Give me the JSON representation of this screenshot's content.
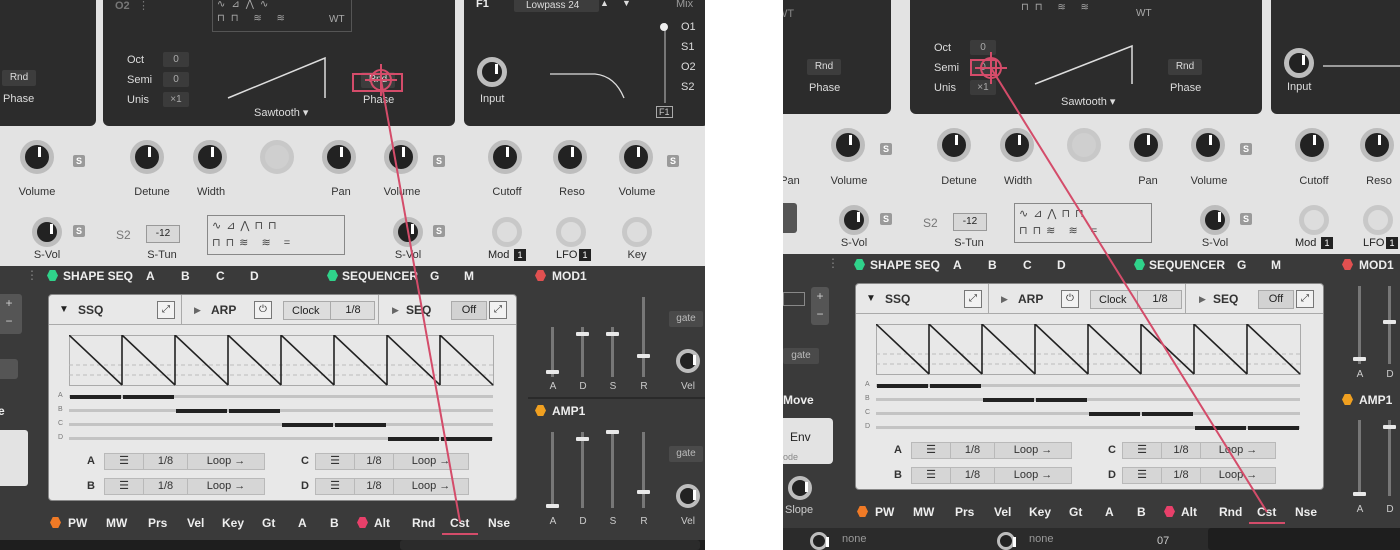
{
  "left": {
    "osc": {
      "title": "O2",
      "oct_label": "Oct",
      "semi_label": "Semi",
      "unis_label": "Unis",
      "oct_value": "0",
      "semi_value": "0",
      "unis_value": "×1",
      "wave_name": "Sawtooth ▾",
      "rnd": "Rnd",
      "phase": "Phase",
      "wt": "WT",
      "left_rnd": "Rnd",
      "left_phase": "Phase"
    },
    "filter": {
      "title": "F1",
      "type": "Lowpass 24",
      "input": "Input",
      "mix": "Mix",
      "routes": [
        "O1",
        "S1",
        "O2",
        "S2"
      ],
      "f1_chip": "F1"
    },
    "knobs": {
      "volume_left": "Volume",
      "detune": "Detune",
      "width": "Width",
      "pan": "Pan",
      "volume": "Volume",
      "cutoff": "Cutoff",
      "reso": "Reso",
      "volume_f": "Volume"
    },
    "sub": {
      "svol_left": "S-Vol",
      "s2": "S2",
      "stun_value": "-12",
      "stun": "S-Tun",
      "svol": "S-Vol",
      "mod": "Mod",
      "lfo": "LFO",
      "key": "Key",
      "mod_badge": "1",
      "lfo_badge": "1"
    },
    "strip": {
      "shape_seq": "SHAPE SEQ",
      "a": "A",
      "b": "B",
      "c": "C",
      "d": "D",
      "sequencer": "SEQUENCER",
      "g": "G",
      "m": "M",
      "mod1": "MOD1",
      "amp1": "AMP1"
    },
    "ssq": {
      "ssq": "SSQ",
      "arp": "ARP",
      "clock": "Clock",
      "clock_value": "1/8",
      "seq": "SEQ",
      "off": "Off"
    },
    "lanes": [
      "A",
      "B",
      "C",
      "D"
    ],
    "rows": [
      {
        "label": "A",
        "rate": "1/8",
        "mode": "Loop →"
      },
      {
        "label": "B",
        "rate": "1/8",
        "mode": "Loop →"
      },
      {
        "label": "C",
        "rate": "1/8",
        "mode": "Loop →"
      },
      {
        "label": "D",
        "rate": "1/8",
        "mode": "Loop →"
      }
    ],
    "env": [
      "A",
      "D",
      "S",
      "R"
    ],
    "gate": "gate",
    "vel": "Vel",
    "bottom": [
      "PW",
      "MW",
      "Prs",
      "Vel",
      "Key",
      "Gt",
      "A",
      "B",
      "Alt",
      "Rnd",
      "Cst",
      "Nse"
    ],
    "left_e": "e"
  },
  "right": {
    "osc": {
      "wt": "WT",
      "oct_label": "Oct",
      "semi_label": "Semi",
      "unis_label": "Unis",
      "oct_value": "0",
      "semi_value": "0",
      "unis_value": "×1",
      "wave_name": "Sawtooth ▾",
      "rnd_left": "Rnd",
      "phase_left": "Phase",
      "rnd": "Rnd",
      "phase": "Phase",
      "input": "Input"
    },
    "knobs": {
      "pan_left": "Pan",
      "volume_left": "Volume",
      "detune": "Detune",
      "width": "Width",
      "pan": "Pan",
      "volume": "Volume",
      "cutoff": "Cutoff",
      "reso": "Reso"
    },
    "sub": {
      "svol_left": "S-Vol",
      "s2": "S2",
      "stun_value": "-12",
      "stun": "S-Tun",
      "svol": "S-Vol",
      "mod": "Mod",
      "lfo": "LFO",
      "mod_badge": "1",
      "lfo_badge": "1"
    },
    "strip": {
      "shape_seq": "SHAPE SEQ",
      "a": "A",
      "b": "B",
      "c": "C",
      "d": "D",
      "sequencer": "SEQUENCER",
      "g": "G",
      "m": "M",
      "mod1": "MOD1",
      "amp1": "AMP1"
    },
    "ssq": {
      "ssq": "SSQ",
      "arp": "ARP",
      "clock": "Clock",
      "clock_value": "1/8",
      "seq": "SEQ",
      "off": "Off"
    },
    "rows": [
      {
        "label": "A",
        "rate": "1/8",
        "mode": "Loop →"
      },
      {
        "label": "B",
        "rate": "1/8",
        "mode": "Loop →"
      },
      {
        "label": "C",
        "rate": "1/8",
        "mode": "Loop →"
      },
      {
        "label": "D",
        "rate": "1/8",
        "mode": "Loop →"
      }
    ],
    "left_gate": "gate",
    "move": "Move",
    "env": "Env",
    "mode": "ode",
    "slope": "Slope",
    "env_labels": [
      "A",
      "D"
    ],
    "bottom": [
      "PW",
      "MW",
      "Prs",
      "Vel",
      "Key",
      "Gt",
      "A",
      "B",
      "Alt",
      "Rnd",
      "Cst",
      "Nse"
    ],
    "none1": "none",
    "none2": "none",
    "num": "07"
  },
  "colors": {
    "accent_pink": "#d44c6a",
    "green": "#2fd28a",
    "orange": "#f07a26",
    "red": "#e05050",
    "gold": "#f0a020"
  }
}
